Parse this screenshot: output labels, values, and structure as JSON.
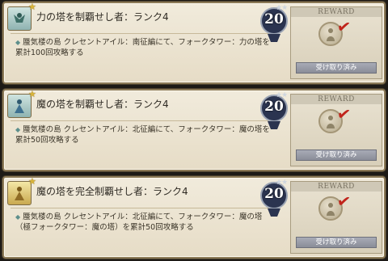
{
  "achievements": [
    {
      "title": "力の塔を制覇せし者：ランク4",
      "description": "蜃気楼の島 クレセントアイル：南征編にて、フォークタワー：力の塔を累計100回攻略する",
      "points": "20",
      "reward_header": "REWARD",
      "claim_label": "受け取り済み"
    },
    {
      "title": "魔の塔を制覇せし者：ランク4",
      "description": "蜃気楼の島 クレセントアイル：北征編にて、フォークタワー：魔の塔を累計50回攻略する",
      "points": "20",
      "reward_header": "REWARD",
      "claim_label": "受け取り済み"
    },
    {
      "title": "魔の塔を完全制覇せし者：ランク4",
      "description": "蜃気楼の島 クレセントアイル：北征編にて、フォークタワー：魔の塔（極フォークタワー：魔の塔）を累計50回攻略する",
      "points": "20",
      "reward_header": "REWARD",
      "claim_label": "受け取り済み"
    }
  ],
  "colors": {
    "claimed_check": "#c0241b",
    "badge": "#2b3450"
  }
}
